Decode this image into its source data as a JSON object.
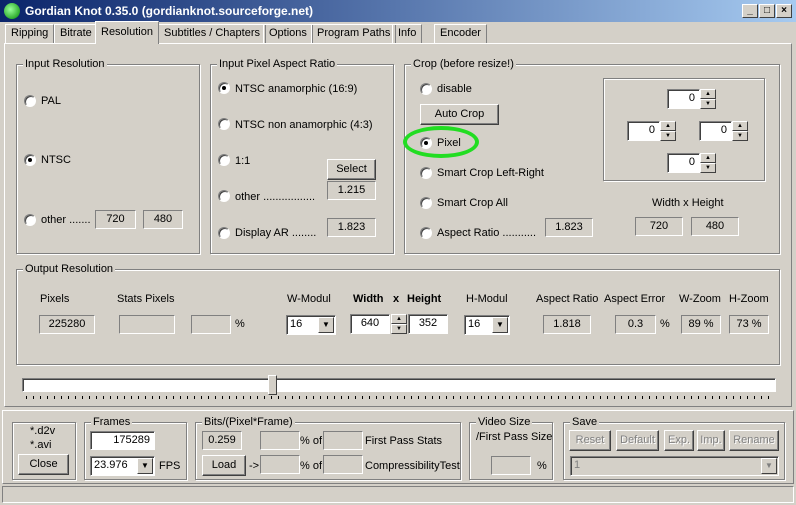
{
  "window": {
    "title": "Gordian Knot 0.35.0  (gordianknot.sourceforge.net)"
  },
  "tabs": [
    "Ripping",
    "Bitrate",
    "Resolution",
    "Subtitles / Chapters",
    "Options",
    "Program Paths",
    "Info",
    "Encoder"
  ],
  "active_tab": "Resolution",
  "input_resolution": {
    "title": "Input Resolution",
    "pal": "PAL",
    "ntsc": "NTSC",
    "other": "other .......",
    "selected": "NTSC",
    "width": "720",
    "height": "480"
  },
  "input_par": {
    "title": "Input Pixel Aspect Ratio",
    "ntsc_ana": "NTSC anamorphic (16:9)",
    "ntsc_non": "NTSC non anamorphic (4:3)",
    "one": "1:1",
    "other": "other .................",
    "display": "Display AR ........",
    "select_button": "Select",
    "other_value": "1.215",
    "display_value": "1.823",
    "selected": "NTSC anamorphic (16:9)"
  },
  "crop": {
    "title": "Crop (before resize!)",
    "disable": "disable",
    "auto_crop_button": "Auto Crop",
    "pixel": "Pixel",
    "smart_lr": "Smart Crop Left-Right",
    "smart_all": "Smart Crop All",
    "aspect": "Aspect Ratio  ...........",
    "aspect_value": "1.823",
    "selected": "Pixel",
    "top": "0",
    "left": "0",
    "right": "0",
    "bottom": "0",
    "wh_label": "Width x Height",
    "width": "720",
    "height": "480",
    "highlight_color": "#22dd22"
  },
  "output": {
    "title": "Output Resolution",
    "pixels_label": "Pixels",
    "pixels_value": "225280",
    "stats_label": "Stats Pixels",
    "stats_value": "",
    "percent_value": "",
    "percent_sign": "%",
    "wmodul_label": "W-Modul",
    "wmodul_value": "16",
    "width_label": "Width",
    "x_label": "x",
    "height_label": "Height",
    "width_value": "640",
    "height_value": "352",
    "hmodul_label": "H-Modul",
    "hmodul_value": "16",
    "ar_label": "Aspect Ratio",
    "ar_value": "1.818",
    "aerr_label": "Aspect Error",
    "aerr_value": "0.3",
    "aerr_pct": "%",
    "wzoom_label": "W-Zoom",
    "wzoom_value": "89 %",
    "hzoom_label": "H-Zoom",
    "hzoom_value": "73 %"
  },
  "slider": {
    "position_fraction": 0.33
  },
  "bottom": {
    "files": {
      "d2v": "*.d2v",
      "avi": "*.avi",
      "close_button": "Close"
    },
    "frames": {
      "title": "Frames",
      "value": "175289",
      "fps_value": "23.976",
      "fps_label": "FPS"
    },
    "bpf": {
      "title": "Bits/(Pixel*Frame)",
      "value": "0.259",
      "pct_of_1": "% of",
      "first_pass": "First Pass Stats",
      "load_button": "Load",
      "arrow": "->",
      "pct_of_2": "% of",
      "compress": "CompressibilityTest"
    },
    "video_size": {
      "title1": "Video Size",
      "title2": "/First Pass Size",
      "pct": "%"
    },
    "save": {
      "title": "Save",
      "reset": "Reset",
      "default": "Default",
      "exp": "Exp.",
      "imp": "Imp.",
      "rename": "Rename",
      "combo_value": "1"
    }
  }
}
